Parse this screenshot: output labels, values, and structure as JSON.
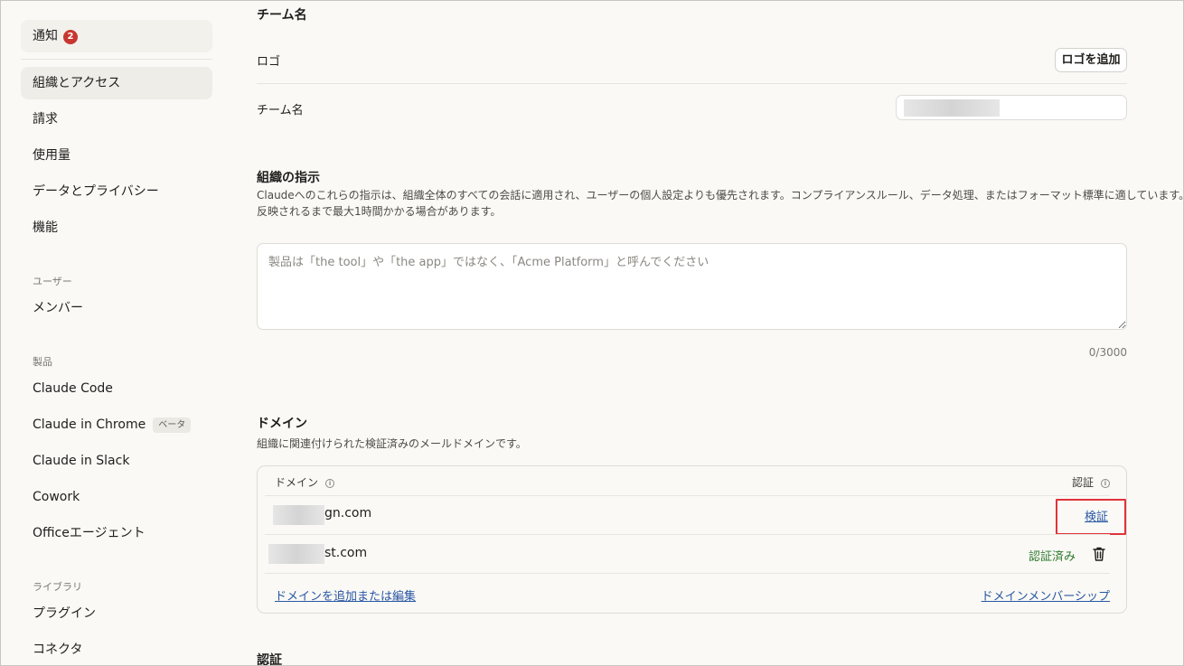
{
  "sidebar": {
    "notifications": {
      "label": "通知",
      "badge": "2"
    },
    "items_top": [
      "組織とアクセス",
      "請求",
      "使用量",
      "データとプライバシー",
      "機能"
    ],
    "sections": {
      "users": {
        "title": "ユーザー",
        "items": [
          "メンバー"
        ]
      },
      "products": {
        "title": "製品",
        "items": [
          "Claude Code",
          "Claude in Chrome",
          "Claude in Slack",
          "Cowork",
          "Officeエージェント"
        ],
        "beta_label": "ベータ"
      },
      "library": {
        "title": "ライブラリ",
        "items": [
          "プラグイン",
          "コネクタ"
        ]
      }
    }
  },
  "main": {
    "team_name_heading": "チーム名",
    "logo_label": "ロゴ",
    "add_logo_button": "ロゴを追加",
    "team_name_label": "チーム名",
    "instructions": {
      "title": "組織の指示",
      "description_line1": "Claudeへのこれらの指示は、組織全体のすべての会話に適用され、ユーザーの個人設定よりも優先されます。コンプライアンスルール、データ処理、またはフォーマット標準に適しています。変更が",
      "description_line2": "反映されるまで最大1時間かかる場合があります。",
      "placeholder": "製品は「the tool」や「the app」ではなく、「Acme Platform」と呼んでください",
      "counter": "0/3000"
    },
    "domains": {
      "title": "ドメイン",
      "description": "組織に関連付けられた検証済みのメールドメインです。",
      "col_domain": "ドメイン",
      "col_auth": "認証",
      "rows": [
        {
          "domain_suffix": "gn.com",
          "action": "検証"
        },
        {
          "domain_suffix": "st.com",
          "status": "認証済み"
        }
      ],
      "add_edit_link": "ドメインを追加または編集",
      "membership_link": "ドメインメンバーシップ"
    },
    "auth_heading": "認証"
  }
}
